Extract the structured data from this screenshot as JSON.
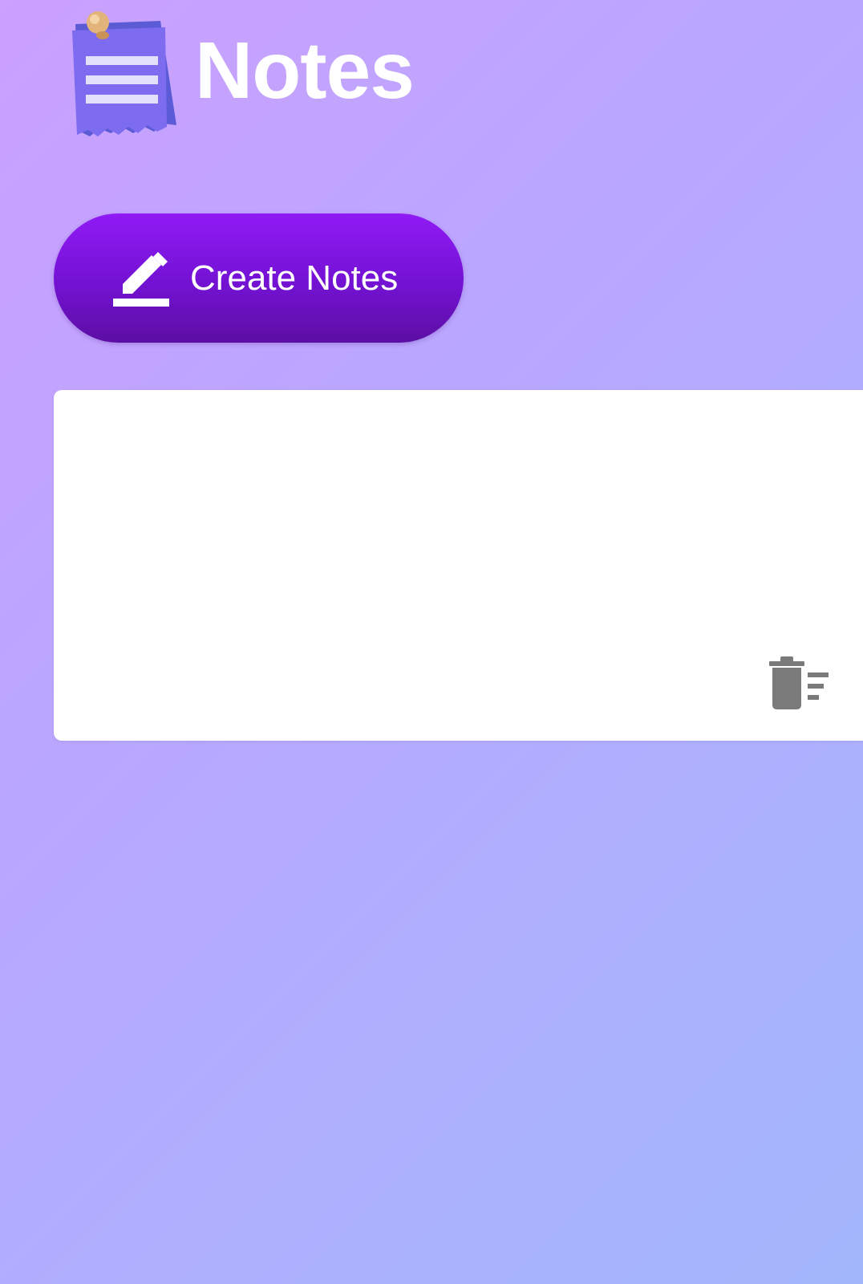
{
  "header": {
    "title": "Notes",
    "logo_icon": "notes-pinned-paper-icon"
  },
  "actions": {
    "create_label": "Create Notes",
    "create_icon": "pencil-edit-icon"
  },
  "notes": [
    {
      "content": "",
      "delete_icon": "delete-sweep-icon"
    }
  ],
  "colors": {
    "button_top": "#901bf5",
    "button_bottom": "#5c0ea3",
    "background_start": "#cba0fe",
    "background_end": "#a2b6fc",
    "card": "#ffffff",
    "icon_gray": "#7a7a7a"
  }
}
